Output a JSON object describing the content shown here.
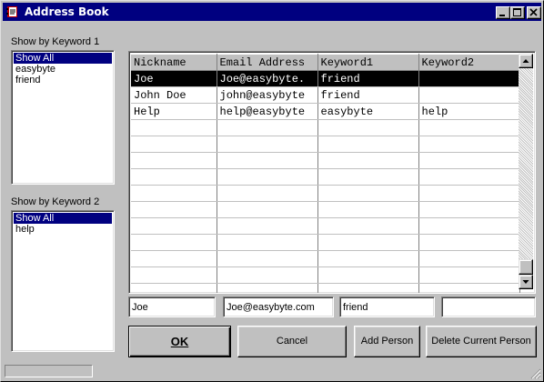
{
  "window": {
    "title": "Address Book"
  },
  "keyword1": {
    "label": "Show by Keyword 1",
    "items": [
      "Show All",
      "easybyte",
      "friend"
    ],
    "selected": 0
  },
  "keyword2": {
    "label": "Show by Keyword 2",
    "items": [
      "Show All",
      "help"
    ],
    "selected": 0
  },
  "grid": {
    "columns": [
      "Nickname",
      "Email Address",
      "Keyword1",
      "Keyword2"
    ],
    "rows": [
      [
        "Joe",
        "Joe@easybyte.",
        "friend",
        ""
      ],
      [
        "John Doe",
        "john@easybyte",
        "friend",
        ""
      ],
      [
        "Help",
        "help@easybyte",
        "easybyte",
        "help"
      ]
    ],
    "selected_row": 0,
    "empty_rows": 11
  },
  "fields": {
    "nickname": "Joe",
    "email": "Joe@easybyte.com",
    "keyword1": "friend",
    "keyword2": ""
  },
  "buttons": {
    "ok": "OK",
    "cancel": "Cancel",
    "add_person": "Add Person",
    "delete_person": "Delete Current Person"
  },
  "colors": {
    "titlebar": "#000080",
    "selection": "#000080",
    "grid_selection": "#000000",
    "face": "#c0c0c0"
  },
  "icons": {
    "app": "address-book-icon",
    "minimize": "minimize-icon",
    "maximize": "maximize-icon",
    "close": "close-icon"
  }
}
